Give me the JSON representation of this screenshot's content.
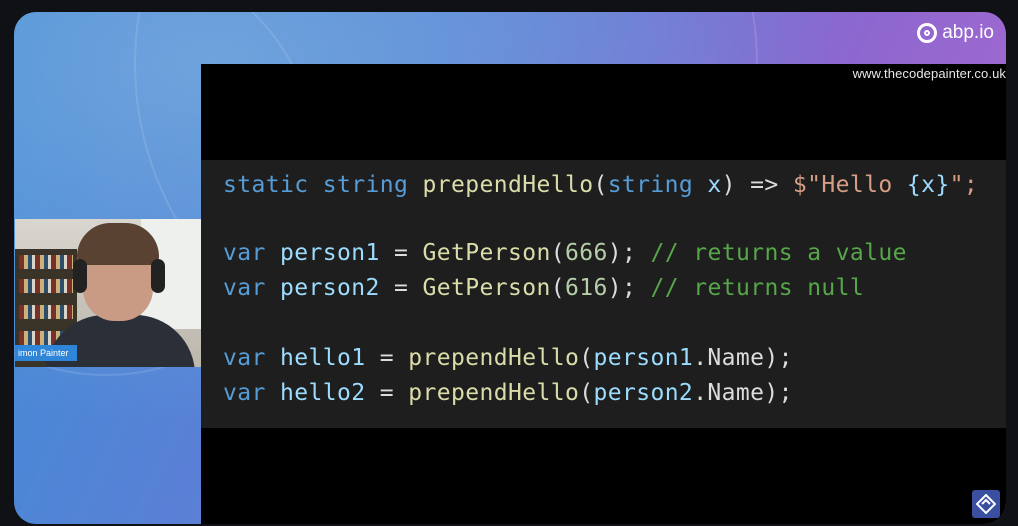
{
  "branding": {
    "logo_text": "abp.io",
    "website": "www.thecodepainter.co.uk"
  },
  "code": {
    "lines": [
      [
        {
          "t": "static ",
          "c": "kw"
        },
        {
          "t": "string ",
          "c": "kw"
        },
        {
          "t": "prependHello",
          "c": "fn"
        },
        {
          "t": "(",
          "c": "id"
        },
        {
          "t": "string ",
          "c": "kw"
        },
        {
          "t": "x",
          "c": "var"
        },
        {
          "t": ") => ",
          "c": "id"
        },
        {
          "t": "$\"Hello ",
          "c": "str"
        },
        {
          "t": "{x}",
          "c": "var"
        },
        {
          "t": "\";",
          "c": "str"
        }
      ],
      [],
      [
        {
          "t": "var ",
          "c": "kw"
        },
        {
          "t": "person1",
          "c": "var"
        },
        {
          "t": " = ",
          "c": "id"
        },
        {
          "t": "GetPerson",
          "c": "fn"
        },
        {
          "t": "(",
          "c": "id"
        },
        {
          "t": "666",
          "c": "num"
        },
        {
          "t": "); ",
          "c": "id"
        },
        {
          "t": "// returns a value",
          "c": "cmt"
        }
      ],
      [
        {
          "t": "var ",
          "c": "kw"
        },
        {
          "t": "person2",
          "c": "var"
        },
        {
          "t": " = ",
          "c": "id"
        },
        {
          "t": "GetPerson",
          "c": "fn"
        },
        {
          "t": "(",
          "c": "id"
        },
        {
          "t": "616",
          "c": "num"
        },
        {
          "t": "); ",
          "c": "id"
        },
        {
          "t": "// returns null",
          "c": "cmt"
        }
      ],
      [],
      [
        {
          "t": "var ",
          "c": "kw"
        },
        {
          "t": "hello1",
          "c": "var"
        },
        {
          "t": " = ",
          "c": "id"
        },
        {
          "t": "prependHello",
          "c": "fn"
        },
        {
          "t": "(",
          "c": "id"
        },
        {
          "t": "person1",
          "c": "var"
        },
        {
          "t": ".Name);",
          "c": "id"
        }
      ],
      [
        {
          "t": "var ",
          "c": "kw"
        },
        {
          "t": "hello2",
          "c": "var"
        },
        {
          "t": " = ",
          "c": "id"
        },
        {
          "t": "prependHello",
          "c": "fn"
        },
        {
          "t": "(",
          "c": "id"
        },
        {
          "t": "person2",
          "c": "var"
        },
        {
          "t": ".Name);",
          "c": "id"
        }
      ]
    ]
  },
  "speaker": {
    "name": "imon Painter"
  },
  "colors": {
    "code_bg": "#1e1e1e",
    "keyword": "#569cd6",
    "function": "#dcdcaa",
    "comment": "#57a64a",
    "nameplate": "#2f86d8"
  },
  "icons": [
    "abp-logo-icon",
    "presenter-brand-icon"
  ]
}
